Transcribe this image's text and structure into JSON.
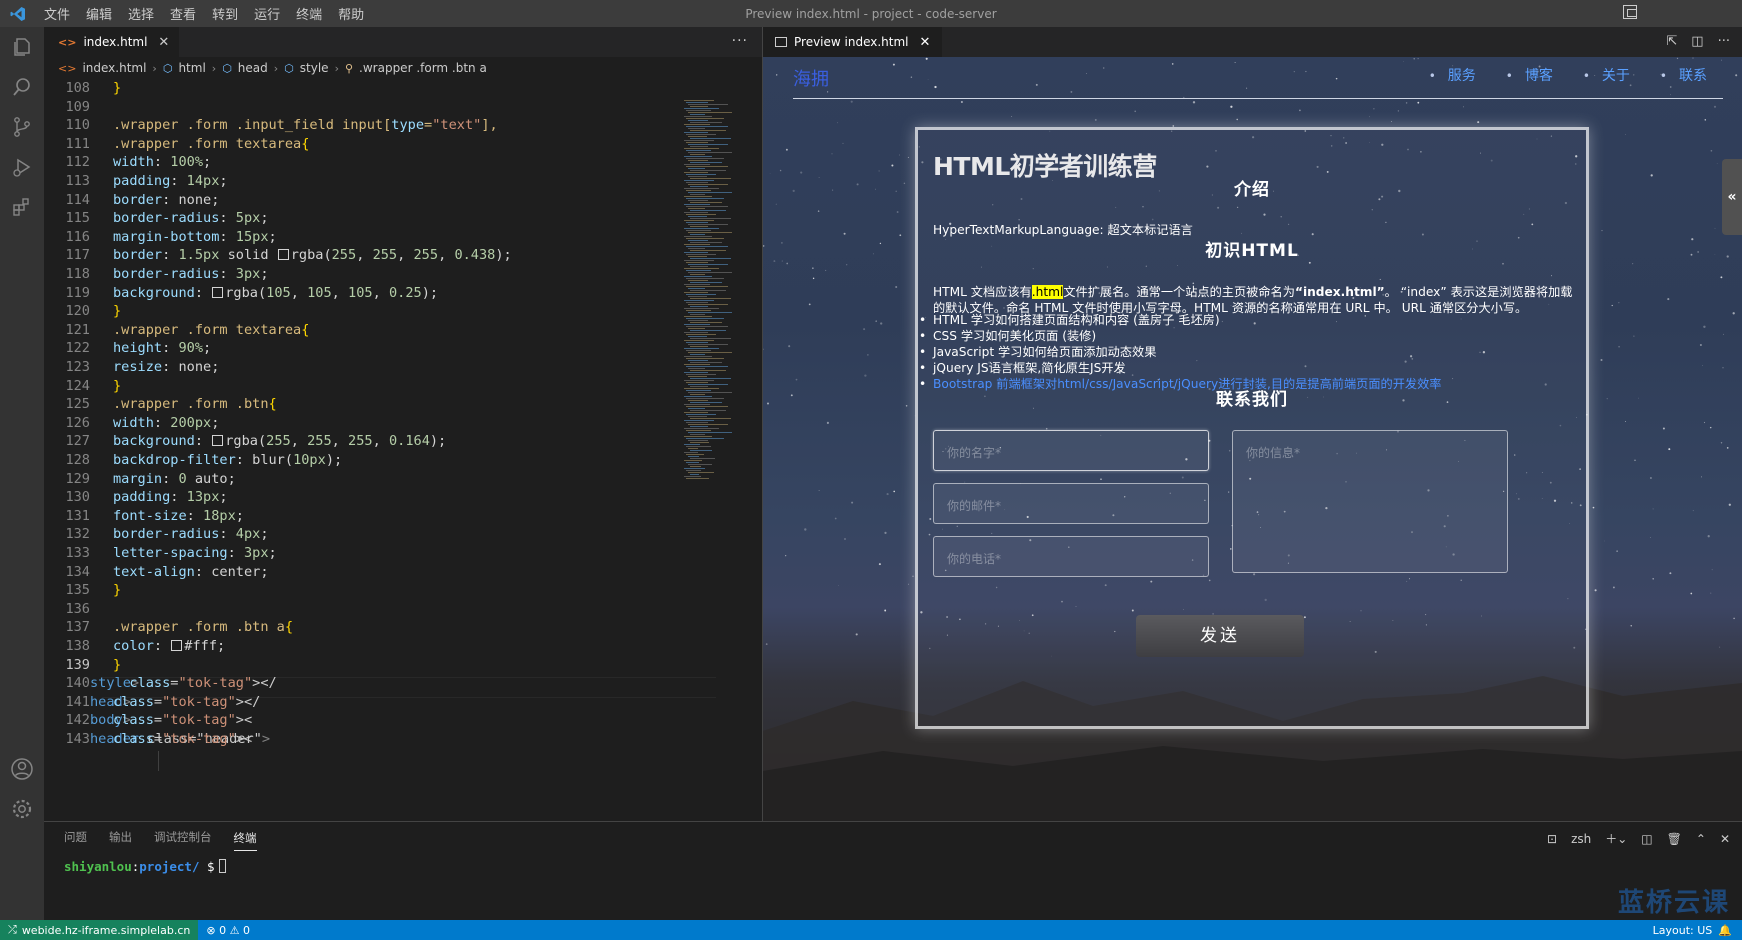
{
  "titlebar": {
    "menu": [
      "文件",
      "编辑",
      "选择",
      "查看",
      "转到",
      "运行",
      "终端",
      "帮助"
    ],
    "window_title": "Preview index.html - project - code-server"
  },
  "editor": {
    "tab_label": "index.html",
    "breadcrumb": [
      "index.html",
      "html",
      "head",
      "style",
      ".wrapper .form .btn a"
    ],
    "lines": [
      {
        "n": "108",
        "t": "}"
      },
      {
        "n": "109",
        "t": ""
      },
      {
        "n": "110",
        "t": ".wrapper .form .input_field input[type=\"text\"],"
      },
      {
        "n": "111",
        "t": ".wrapper .form textarea{"
      },
      {
        "n": "112",
        "t": "width: 100%;"
      },
      {
        "n": "113",
        "t": "padding: 14px;"
      },
      {
        "n": "114",
        "t": "border: none;"
      },
      {
        "n": "115",
        "t": "border-radius: 5px;"
      },
      {
        "n": "116",
        "t": "margin-bottom: 15px;"
      },
      {
        "n": "117",
        "t": "border: 1.5px solid ■rgba(255, 255, 255, 0.438);"
      },
      {
        "n": "118",
        "t": "border-radius: 3px;"
      },
      {
        "n": "119",
        "t": "background: ■rgba(105, 105, 105, 0.25);"
      },
      {
        "n": "120",
        "t": "}"
      },
      {
        "n": "121",
        "t": ".wrapper .form textarea{"
      },
      {
        "n": "122",
        "t": "height: 90%;"
      },
      {
        "n": "123",
        "t": "resize: none;"
      },
      {
        "n": "124",
        "t": "}"
      },
      {
        "n": "125",
        "t": ".wrapper .form .btn{"
      },
      {
        "n": "126",
        "t": "width: 200px;"
      },
      {
        "n": "127",
        "t": "background: ■rgba(255, 255, 255, 0.164);"
      },
      {
        "n": "128",
        "t": "backdrop-filter: blur(10px);"
      },
      {
        "n": "129",
        "t": "margin: 0 auto;"
      },
      {
        "n": "130",
        "t": "padding: 13px;"
      },
      {
        "n": "131",
        "t": "font-size: 18px;"
      },
      {
        "n": "132",
        "t": "border-radius: 4px;"
      },
      {
        "n": "133",
        "t": "letter-spacing: 3px;"
      },
      {
        "n": "134",
        "t": "text-align: center;"
      },
      {
        "n": "135",
        "t": "}"
      },
      {
        "n": "136",
        "t": ""
      },
      {
        "n": "137",
        "t": ".wrapper .form .btn a{"
      },
      {
        "n": "138",
        "t": "color: ■#fff;"
      },
      {
        "n": "139",
        "t": "}"
      },
      {
        "n": "140",
        "t": "  </style>"
      },
      {
        "n": "141",
        "t": "</head>"
      },
      {
        "n": "142",
        "t": "<body>"
      },
      {
        "n": "143",
        "t": "<header class=\"header\">"
      }
    ]
  },
  "preview": {
    "tab_label": "Preview index.html",
    "logo": "海拥",
    "menu": [
      "服务",
      "博客",
      "关于",
      "联系"
    ],
    "title": "HTML初学者训练营",
    "h_intro": "介绍",
    "intro_text": "HyperTextMarkupLanguage: 超文本标记语言",
    "h_learn": "初识HTML",
    "para_before": "HTML 文档应该有",
    "para_highlight": ".html",
    "para_mid": "文件扩展名。通常一个站点的主页被命名为",
    "para_bold": "“index.html”",
    "para_after": "。 “index” 表示这是浏览器将加载的默认文件。命名 HTML 文件时使用小写字母。HTML 资源的名称通常用在 URL 中。 URL 通常区分大小写。",
    "list": [
      "HTML 学习如何搭建页面结构和内容 (盖房子 毛坯房)",
      "CSS 学习如何美化页面 (装修)",
      "JavaScript 学习如何给页面添加动态效果",
      "jQuery JS语言框架,简化原生JS开发",
      "Bootstrap 前端框架对html/css/JavaScript/jQuery进行封装,目的是提高前端页面的开发效率"
    ],
    "h_contact": "联系我们",
    "name_placeholder": "你的名字*",
    "email_placeholder": "你的邮件*",
    "phone_placeholder": "你的电话*",
    "message_placeholder": "你的信息*",
    "send_label": "发送"
  },
  "panel": {
    "tabs": [
      "问题",
      "输出",
      "调试控制台",
      "终端"
    ],
    "shell": "zsh",
    "term_user": "shiyanlou",
    "term_path": "project/",
    "term_prompt": "$",
    "watermark": "蓝桥云课"
  },
  "statusbar": {
    "remote": "webide.hz-iframe.simplelab.cn",
    "errors": "0",
    "warnings": "0",
    "layout": "Layout: US"
  },
  "colors": {
    "accent": "#007acc",
    "remote_bg": "#16825d",
    "link": "#4a8fff"
  }
}
